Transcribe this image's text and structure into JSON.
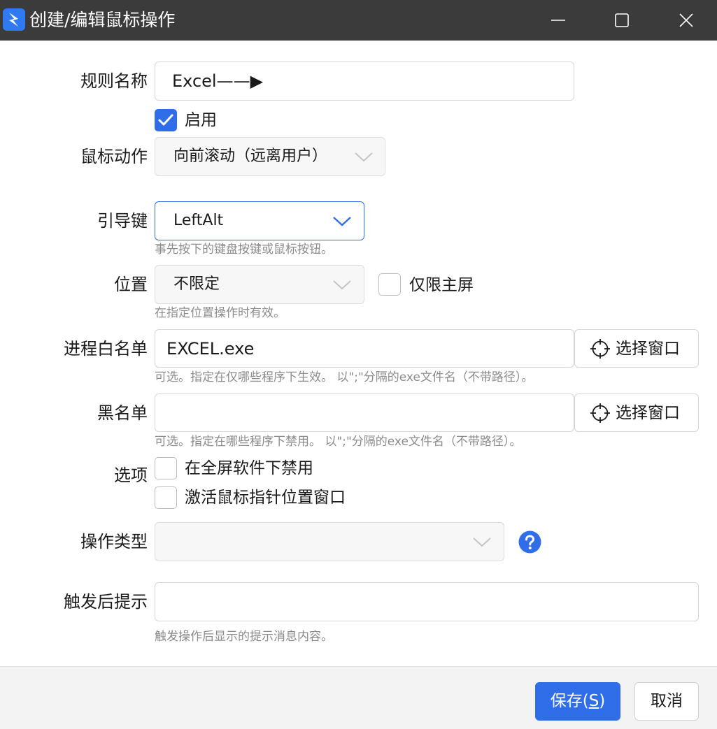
{
  "window": {
    "title": "创建/编辑鼠标操作",
    "icon": "app-logo-icon",
    "controls": {
      "minimize": "minimize-icon",
      "maximize": "maximize-icon",
      "close": "close-icon"
    }
  },
  "form": {
    "rule_name": {
      "label": "规则名称",
      "value": "Excel——▶"
    },
    "enabled": {
      "label": "启用",
      "checked": true
    },
    "mouse_action": {
      "label": "鼠标动作",
      "value": "向前滚动（远离用户）"
    },
    "guide_key": {
      "label": "引导键",
      "value": "LeftAlt",
      "help": "事先按下的键盘按键或鼠标按钮。"
    },
    "position": {
      "label": "位置",
      "value": "不限定",
      "primary_only_label": "仅限主屏",
      "primary_only_checked": false,
      "help": "在指定位置操作时有效。"
    },
    "process_whitelist": {
      "label": "进程白名单",
      "value": "EXCEL.exe",
      "pick_label": "选择窗口",
      "help": "可选。指定在仅哪些程序下生效。 以\";\"分隔的exe文件名（不带路径）。"
    },
    "blacklist": {
      "label": "黑名单",
      "value": "",
      "pick_label": "选择窗口",
      "help": "可选。指定在哪些程序下禁用。 以\";\"分隔的exe文件名（不带路径）。"
    },
    "options": {
      "label": "选项",
      "fullscreen_disable": {
        "label": "在全屏软件下禁用",
        "checked": false
      },
      "activate_window": {
        "label": "激活鼠标指针位置窗口",
        "checked": false
      }
    },
    "operation_type": {
      "label": "操作类型",
      "value": ""
    },
    "trigger_hint": {
      "label": "触发后提示",
      "value": "",
      "help": "触发操作后显示的提示消息内容。"
    }
  },
  "footer": {
    "save_label": "保存(",
    "save_key": "S",
    "save_suffix": ")",
    "cancel_label": "取消"
  },
  "colors": {
    "titlebar": "#3b3b3b",
    "accent": "#2f6ee8",
    "help_text": "#8c8c8c",
    "footer": "#f3f3f3"
  }
}
